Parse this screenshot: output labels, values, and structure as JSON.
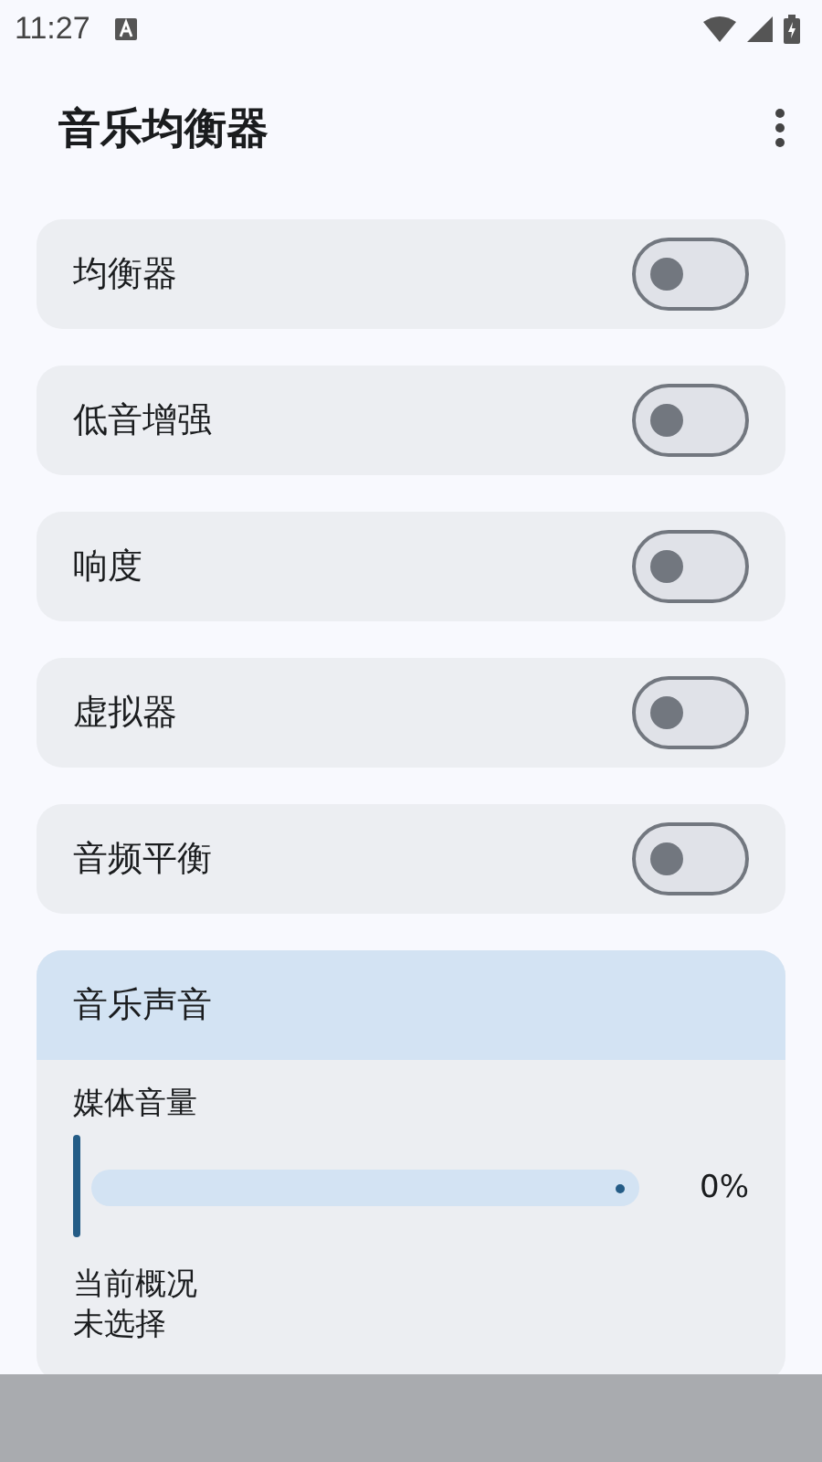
{
  "status_bar": {
    "time": "11:27"
  },
  "app_bar": {
    "title": "音乐均衡器"
  },
  "toggles": [
    {
      "label": "均衡器",
      "on": false
    },
    {
      "label": "低音增强",
      "on": false
    },
    {
      "label": "响度",
      "on": false
    },
    {
      "label": "虚拟器",
      "on": false
    },
    {
      "label": "音频平衡",
      "on": false
    }
  ],
  "section": {
    "title": "音乐声音",
    "slider": {
      "label": "媒体音量",
      "level": 0,
      "reading": "0%"
    },
    "profile": {
      "label": "当前概况",
      "value": "未选择"
    }
  }
}
